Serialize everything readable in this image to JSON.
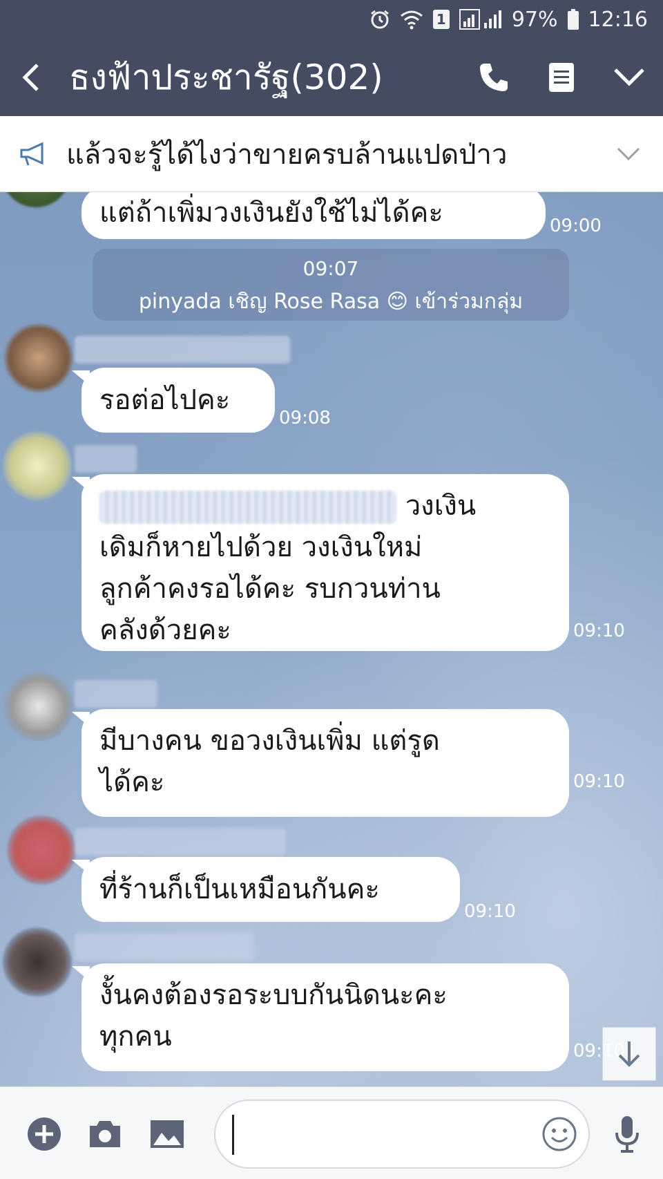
{
  "status_bar": {
    "sim_label": "1",
    "battery_percent": "97%",
    "time": "12:16"
  },
  "header": {
    "title": "ธงฟ้าประชารัฐ(302)"
  },
  "announcement": {
    "text": "แล้วจะรู้ได้ไงว่าขายครบล้านแปดป่าว"
  },
  "messages": [
    {
      "text": "แต่ถ้าเพิ่มวงเงินยังใช้ไม่ได้คะ",
      "time": "09:00"
    },
    {
      "system_time": "09:07",
      "system_text": "pinyada เชิญ Rose Rasa 😊 เข้าร่วมกลุ่ม"
    },
    {
      "text": "รอต่อไปคะ",
      "time": "09:08"
    },
    {
      "lines": [
        "วงเงิน",
        "เดิมก็หายไปด้วย วงเงินใหม่",
        "ลูกค้าคงรอได้คะ รบกวนท่าน",
        "คลังด้วยคะ"
      ],
      "time": "09:10"
    },
    {
      "lines": [
        "มีบางคน ขอวงเงินเพิ่ม แต่รูด",
        "ได้คะ"
      ],
      "time": "09:10"
    },
    {
      "text": "ที่ร้านก็เป็นเหมือนกันคะ",
      "time": "09:10"
    },
    {
      "lines": [
        "งั้นคงต้องรอระบบกันนิดนะคะ",
        "ทุกคน"
      ],
      "time": "09:10"
    }
  ],
  "input": {
    "placeholder": ""
  },
  "colors": {
    "header_bg": "#434c61",
    "chat_bg": "#8aa4c6",
    "bubble_bg": "#ffffff"
  },
  "icons": [
    "alarm-icon",
    "wifi-icon",
    "signal-icon",
    "battery-icon",
    "back-chevron-icon",
    "phone-icon",
    "menu-icon",
    "chevron-down-icon",
    "megaphone-icon",
    "plus-icon",
    "camera-icon",
    "image-icon",
    "emoji-icon",
    "mic-icon",
    "scroll-down-arrow-icon"
  ]
}
